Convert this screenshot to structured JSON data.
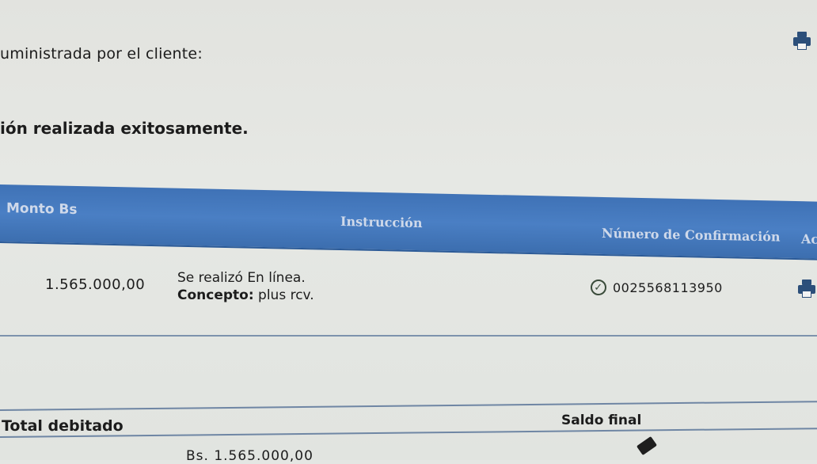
{
  "intro_text": "uministrada por el cliente:",
  "status_text": "ión realizada exitosamente.",
  "table": {
    "headers": {
      "monto": "Monto Bs",
      "instruccion": "Instrucción",
      "confirmacion": "Número de Confirmación",
      "acciones": "Ac"
    },
    "row": {
      "monto": "1.565.000,00",
      "instruccion_line1": "Se realizó En línea.",
      "concepto_label": "Concepto:",
      "concepto_value": "plus rcv.",
      "confirmacion": "0025568113950"
    }
  },
  "totals": {
    "total_label": "Total debitado",
    "saldo_label": "Saldo final",
    "total_value": "Bs. 1.565.000,00"
  },
  "icons": {
    "print": "printer-icon",
    "check": "check-circle-icon",
    "eraser": "eraser-icon"
  },
  "colors": {
    "header_blue": "#4a7fc4",
    "divider": "#6f86a4"
  }
}
